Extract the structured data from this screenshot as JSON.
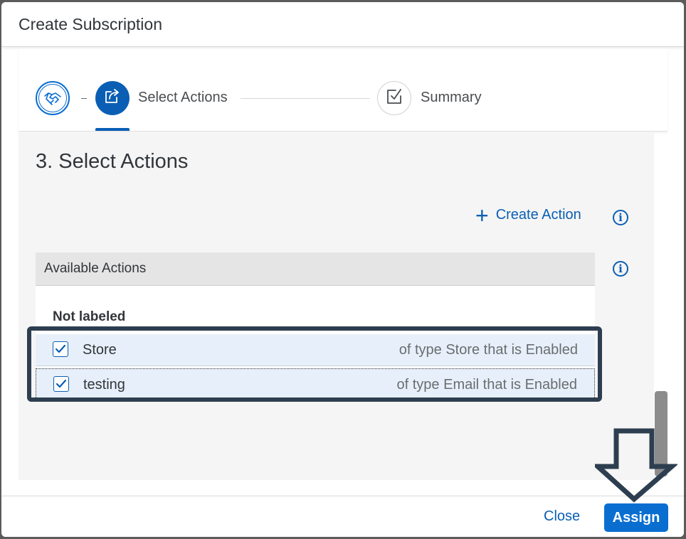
{
  "dialog": {
    "title": "Create Subscription"
  },
  "wizard": {
    "steps": [
      {
        "label": "",
        "icon": "handshake-icon",
        "state": "completed"
      },
      {
        "label": "Select Actions",
        "icon": "share-icon",
        "state": "current"
      },
      {
        "label": "Summary",
        "icon": "checkbox-icon",
        "state": "upcoming"
      }
    ],
    "separator": "-"
  },
  "content": {
    "section_title": "3. Select Actions",
    "create_action_label": "Create Action",
    "panel_title": "Available Actions",
    "group_label": "Not labeled",
    "actions": [
      {
        "name": "Store",
        "description": "of type Store that is Enabled",
        "checked": true
      },
      {
        "name": "testing",
        "description": "of type Email that is Enabled",
        "checked": true
      }
    ]
  },
  "footer": {
    "close_label": "Close",
    "assign_label": "Assign"
  },
  "colors": {
    "accent": "#0a6ed1",
    "accent_dark": "#0a5fb4",
    "annotation": "#2d3e50"
  }
}
